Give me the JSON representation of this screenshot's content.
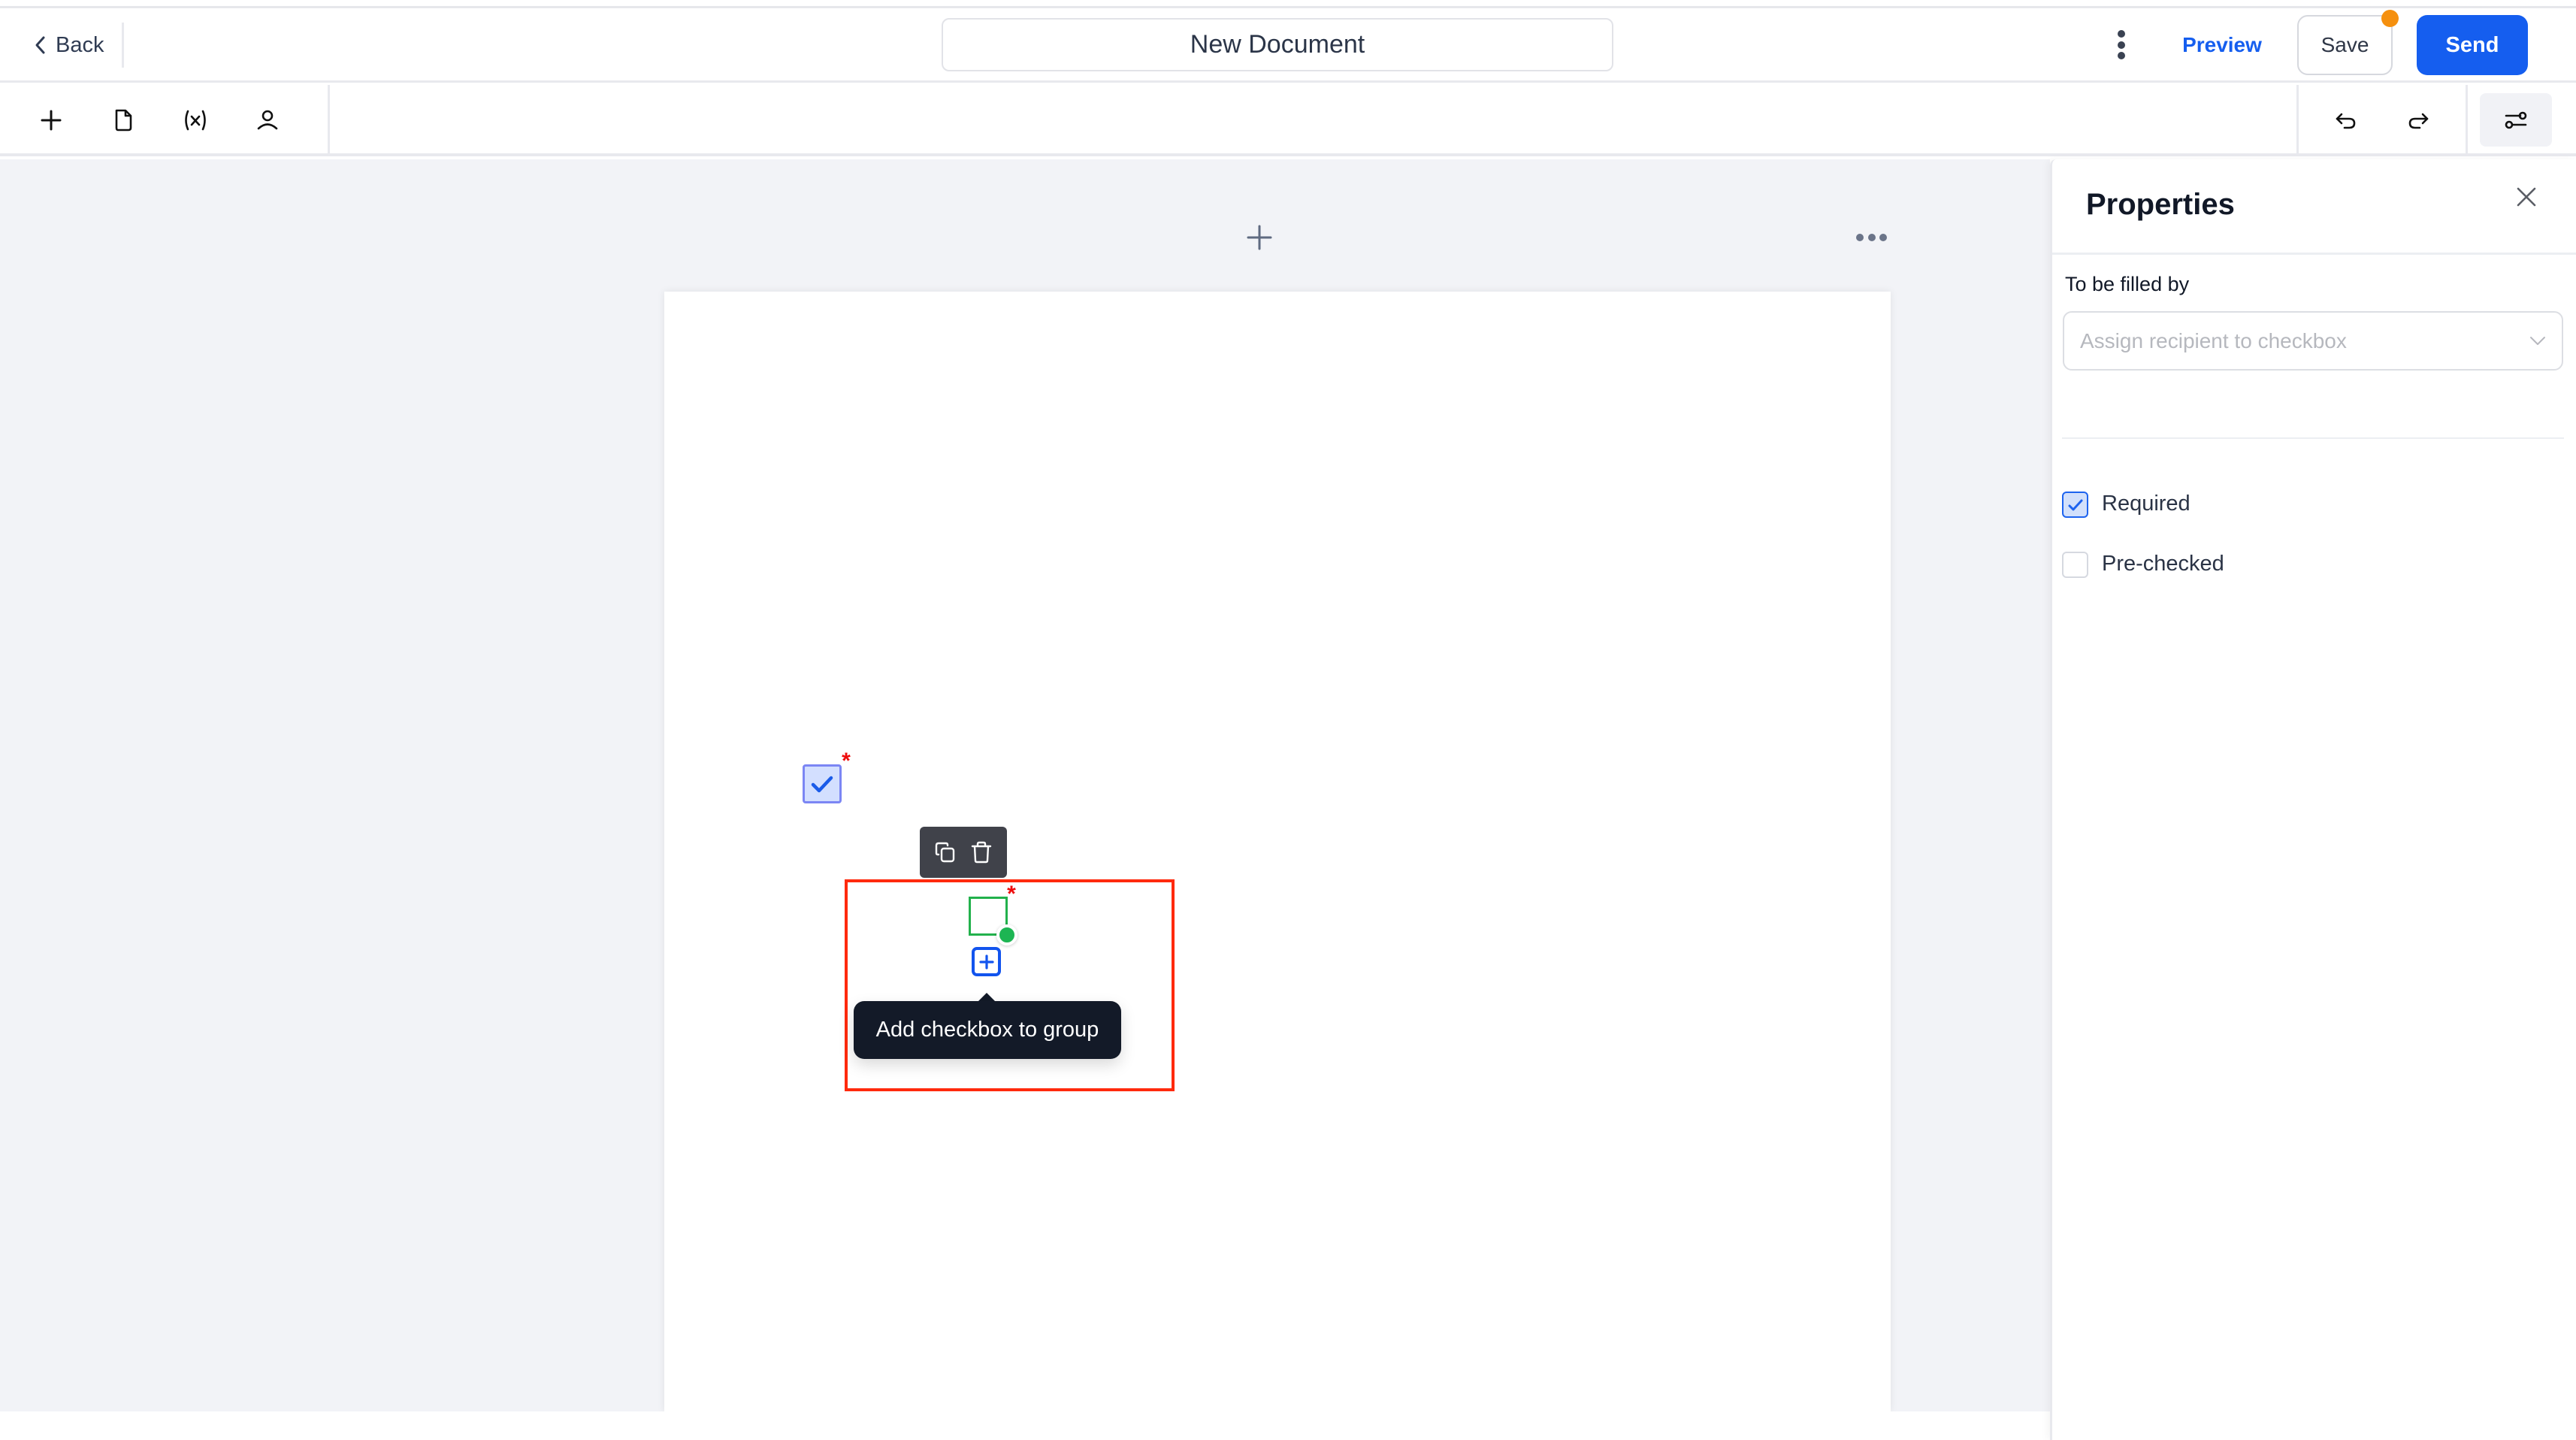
{
  "header": {
    "back_label": "Back",
    "document_title": "New Document",
    "preview_label": "Preview",
    "save_label": "Save",
    "send_label": "Send",
    "unsaved_indicator_color": "#F5900F",
    "accent_color": "#155EEF"
  },
  "toolbar": {
    "left_icons": [
      "plus-icon",
      "document-icon",
      "variable-icon",
      "person-icon"
    ],
    "right_icons": [
      "undo-icon",
      "redo-icon",
      "settings-sliders-icon"
    ]
  },
  "canvas": {
    "add_page_icon": "plus-icon",
    "page_menu_icon": "ellipsis-icon",
    "fields": [
      {
        "type": "checkbox",
        "checked": true,
        "required": true,
        "required_marker": "*"
      },
      {
        "type": "checkbox-group-item",
        "checked": false,
        "required": true,
        "required_marker": "*",
        "selected": true
      }
    ],
    "field_toolbar": {
      "actions": [
        "copy-icon",
        "trash-icon"
      ]
    },
    "tooltip": "Add checkbox to group"
  },
  "properties": {
    "title": "Properties",
    "filled_by_label": "To be filled by",
    "recipient_placeholder": "Assign recipient to checkbox",
    "options": [
      {
        "label": "Required",
        "checked": true
      },
      {
        "label": "Pre-checked",
        "checked": false
      }
    ]
  }
}
